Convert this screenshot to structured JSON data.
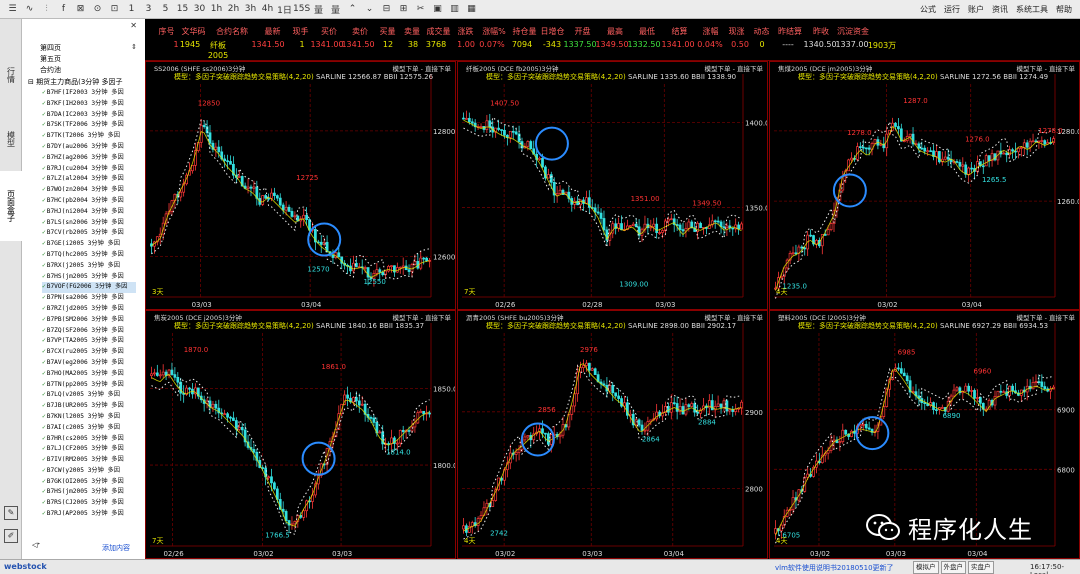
{
  "toolbar": {
    "icons": [
      "list-icon",
      "line-chart-icon",
      "candle-chart-icon",
      "formula-icon",
      "close-icon",
      "clock-icon",
      "tick-icon",
      "1m",
      "3m",
      "5m",
      "15m",
      "30m",
      "1h",
      "2h",
      "3h",
      "4h",
      "1d",
      "15s",
      "week-icon",
      "month-icon",
      "zoom-in-icon",
      "zoom-out-icon",
      "collapse-icon",
      "expand-icon",
      "scissors-icon",
      "fullscreen-icon",
      "align-icon",
      "grid-icon"
    ],
    "icon_glyphs": [
      "☰",
      "∿",
      "⫶",
      "f",
      "⊠",
      "⊙",
      "⊡",
      "1",
      "3",
      "5",
      "15",
      "30",
      "1h",
      "2h",
      "3h",
      "4h",
      "1日",
      "15S",
      "量",
      "量",
      "⌃",
      "⌄",
      "⊟",
      "⊞",
      "✂",
      "▣",
      "▥",
      "▦"
    ],
    "menu": [
      "公式",
      "运行",
      "账户",
      "资讯",
      "系统工具",
      "帮助"
    ]
  },
  "left_tabs": [
    "行情",
    "模型",
    "页面盒子"
  ],
  "sidebar": {
    "pages": [
      "第四页",
      "第五页",
      "合约池"
    ],
    "tree_root": "期货主力商品(3分钟 多因子",
    "items": [
      "B7HF(IF2003 3分钟 多因",
      "B7KF(IH2003 3分钟 多因",
      "B7DA(IC2003 3分钟 多因",
      "B7SK(TF2006 3分钟 多因",
      "B7TK(T2006 3分钟 多因",
      "B7DY(au2006 3分钟 多因",
      "B7HZ(ag2006 3分钟 多因",
      "B7RJ(cu2004 3分钟 多因",
      "B7LZ(al2004 3分钟 多因",
      "B7WO(zn2004 3分钟 多因",
      "B7HC(pb2004 3分钟 多因",
      "B7HJ(ni2004 3分钟 多因",
      "B7LS(sn2006 3分钟 多因",
      "B7CV(rb2005 3分钟 多因",
      "B7GE(i2005 3分钟 多因",
      "B7TQ(hc2005 3分钟 多因",
      "B7RX(j2005 3分钟 多因",
      "B7HS(jm2005 3分钟 多因",
      "B7VOF(FG2006 3分钟 多因",
      "B7PN(sa2006 3分钟 多因",
      "B7RZ(jd2005 3分钟 多因",
      "B7PB(SM2006 3分钟 多因",
      "B7ZQ(SF2006 3分钟 多因",
      "B7VP(TA2005 3分钟 多因",
      "B7CX(ru2005 3分钟 多因",
      "B7AV(eg2006 3分钟 多因",
      "B7HO(MA2005 3分钟 多因",
      "B7TN(pp2005 3分钟 多因",
      "B7LQ(v2005 3分钟 多因",
      "B7JB(UR2005 3分钟 多因",
      "B7KN(l2005 3分钟 多因",
      "B7AI(c2005 3分钟 多因",
      "B7HR(cs2005 3分钟 多因",
      "B7LJ(CF2005 3分钟 多因",
      "B7IV(RM2005 3分钟 多因",
      "B7CW(y2005 3分钟 多因",
      "B7GK(OI2005 3分钟 多因",
      "B7HS(jm2005 3分钟 多因",
      "B7RS(CJ2005 3分钟 多因",
      "B7RJ(AP2005 3分钟 多因"
    ],
    "selected_index": 18,
    "add_label": "添加内容"
  },
  "quote": {
    "headers": [
      "序号",
      "文华码",
      "合约名称",
      "最新",
      "现手",
      "买价",
      "卖价",
      "买量",
      "卖量",
      "成交量",
      "涨跌",
      "涨幅%",
      "持仓量",
      "日增仓",
      "开盘",
      "最高",
      "最低",
      "结算",
      "涨幅",
      "现涨",
      "动态",
      "昨结算",
      "昨收",
      "沉淀资金"
    ],
    "values": [
      "1",
      "1945",
      "纤板2005",
      "1341.50",
      "1",
      "1341.00",
      "1341.50",
      "12",
      "38",
      "3768",
      "1.00",
      "0.07%",
      "7094",
      "-343",
      "1337.50",
      "1349.50",
      "1332.50",
      "1341.00",
      "0.04%",
      "0.50",
      "0",
      "----",
      "1340.50",
      "1337.00",
      "1903万"
    ],
    "value_colors": [
      "#ff4040",
      "#e6e600",
      "#e6e600",
      "#ff4040",
      "#e6e600",
      "#ff4040",
      "#ff4040",
      "#e6e600",
      "#e6e600",
      "#e6e600",
      "#ff4040",
      "#ff4040",
      "#e6e600",
      "#e6e600",
      "#3ee03e",
      "#ff4040",
      "#3ee03e",
      "#ff4040",
      "#ff4040",
      "#ff4040",
      "#e6e600",
      "#ddd",
      "#ddd",
      "#ddd",
      "#e6e600"
    ]
  },
  "model": {
    "name": "模型：多因子突破跟踪趋势交易策略(4,2,20)",
    "order_label": "模型下单 - 直接下单"
  },
  "panels": [
    {
      "title": "SS2006 (SHFE ss2006)3分钟",
      "sarline": "SARLINE 12566.87",
      "bbii": "BBII 12575.26",
      "yticks": [
        {
          "v": "12800",
          "p": 0.22
        },
        {
          "v": "12600",
          "p": 0.81
        }
      ],
      "xticks": [
        {
          "v": "03/03",
          "p": 0.18
        },
        {
          "v": "03/04",
          "p": 0.57
        }
      ],
      "period": "3天",
      "labels": [
        {
          "t": "12850",
          "x": 0.17,
          "y": 0.1,
          "c": "red"
        },
        {
          "t": "12725",
          "x": 0.52,
          "y": 0.45,
          "c": "red"
        },
        {
          "t": "12570",
          "x": 0.56,
          "y": 0.88,
          "c": "cyan"
        },
        {
          "t": "12550",
          "x": 0.76,
          "y": 0.94,
          "c": "cyan"
        }
      ],
      "circle": {
        "x": 0.62,
        "y": 0.73
      },
      "path": [
        0.75,
        0.72,
        0.6,
        0.52,
        0.45,
        0.35,
        0.2,
        0.28,
        0.32,
        0.38,
        0.42,
        0.48,
        0.5,
        0.55,
        0.52,
        0.56,
        0.6,
        0.64,
        0.62,
        0.7,
        0.75,
        0.78,
        0.8,
        0.84,
        0.86,
        0.85,
        0.9,
        0.88,
        0.86,
        0.87,
        0.85,
        0.86,
        0.83,
        0.82
      ]
    },
    {
      "title": "纤板2005 (DCE fb2005)3分钟",
      "sarline": "SARLINE 1335.60",
      "bbii": "BBII 1338.90",
      "yticks": [
        {
          "v": "1400.00",
          "p": 0.18
        },
        {
          "v": "1350.00",
          "p": 0.58
        }
      ],
      "xticks": [
        {
          "v": "02/26",
          "p": 0.15
        },
        {
          "v": "02/28",
          "p": 0.46
        },
        {
          "v": "03/03",
          "p": 0.72
        }
      ],
      "period": "7天",
      "labels": [
        {
          "t": "1407.50",
          "x": 0.1,
          "y": 0.1,
          "c": "red"
        },
        {
          "t": "1351.00",
          "x": 0.6,
          "y": 0.55,
          "c": "red"
        },
        {
          "t": "1349.50",
          "x": 0.82,
          "y": 0.57,
          "c": "red"
        },
        {
          "t": "1309.00",
          "x": 0.56,
          "y": 0.95,
          "c": "cyan"
        }
      ],
      "circle": {
        "x": 0.32,
        "y": 0.28
      },
      "path": [
        0.16,
        0.18,
        0.2,
        0.19,
        0.22,
        0.24,
        0.25,
        0.28,
        0.3,
        0.36,
        0.44,
        0.52,
        0.5,
        0.55,
        0.54,
        0.56,
        0.62,
        0.72,
        0.66,
        0.68,
        0.66,
        0.7,
        0.65,
        0.68,
        0.66,
        0.64,
        0.7,
        0.66,
        0.68,
        0.66,
        0.64,
        0.68,
        0.66,
        0.68
      ]
    },
    {
      "title": "焦煤2005 (DCE jm2005)3分钟",
      "sarline": "SARLINE 1272.56",
      "bbii": "BBII 1274.49",
      "yticks": [
        {
          "v": "1280.0",
          "p": 0.22
        },
        {
          "v": "1260.0",
          "p": 0.55
        }
      ],
      "xticks": [
        {
          "v": "03/02",
          "p": 0.4
        },
        {
          "v": "03/04",
          "p": 0.7
        }
      ],
      "period": "4天",
      "labels": [
        {
          "t": "1278.0",
          "x": 0.26,
          "y": 0.24,
          "c": "red"
        },
        {
          "t": "1287.0",
          "x": 0.46,
          "y": 0.09,
          "c": "red"
        },
        {
          "t": "1276.0",
          "x": 0.68,
          "y": 0.27,
          "c": "red"
        },
        {
          "t": "1278.0",
          "x": 0.94,
          "y": 0.23,
          "c": "red"
        },
        {
          "t": "1265.5",
          "x": 0.74,
          "y": 0.46,
          "c": "cyan"
        },
        {
          "t": "1235.0",
          "x": 0.03,
          "y": 0.96,
          "c": "cyan"
        }
      ],
      "circle": {
        "x": 0.27,
        "y": 0.5
      },
      "path": [
        0.96,
        0.85,
        0.8,
        0.78,
        0.72,
        0.75,
        0.68,
        0.6,
        0.42,
        0.36,
        0.3,
        0.33,
        0.26,
        0.28,
        0.18,
        0.26,
        0.24,
        0.3,
        0.32,
        0.33,
        0.36,
        0.34,
        0.4,
        0.42,
        0.38,
        0.36,
        0.34,
        0.3,
        0.32,
        0.28,
        0.3,
        0.26,
        0.28,
        0.26
      ]
    },
    {
      "title": "焦炭2005 (DCE j2005)3分钟",
      "sarline": "SARLINE 1840.16",
      "bbii": "BBII 1835.37",
      "yticks": [
        {
          "v": "1850.0",
          "p": 0.26
        },
        {
          "v": "1800.0",
          "p": 0.62
        }
      ],
      "xticks": [
        {
          "v": "02/26",
          "p": 0.08
        },
        {
          "v": "03/02",
          "p": 0.4
        },
        {
          "v": "03/03",
          "p": 0.68
        }
      ],
      "period": "7天",
      "labels": [
        {
          "t": "1870.0",
          "x": 0.12,
          "y": 0.09,
          "c": "red"
        },
        {
          "t": "1861.0",
          "x": 0.61,
          "y": 0.17,
          "c": "red"
        },
        {
          "t": "1814.0",
          "x": 0.84,
          "y": 0.57,
          "c": "cyan"
        },
        {
          "t": "1766.5",
          "x": 0.41,
          "y": 0.96,
          "c": "cyan"
        }
      ],
      "circle": {
        "x": 0.6,
        "y": 0.59
      },
      "path": [
        0.2,
        0.22,
        0.18,
        0.24,
        0.28,
        0.26,
        0.3,
        0.34,
        0.36,
        0.4,
        0.44,
        0.48,
        0.55,
        0.62,
        0.7,
        0.78,
        0.88,
        0.9,
        0.82,
        0.76,
        0.65,
        0.55,
        0.42,
        0.3,
        0.32,
        0.35,
        0.4,
        0.48,
        0.52,
        0.5,
        0.46,
        0.42,
        0.38,
        0.36
      ]
    },
    {
      "title": "沥青2005 (SHFE bu2005)3分钟",
      "sarline": "SARLINE 2898.00",
      "bbii": "BBII 2902.17",
      "yticks": [
        {
          "v": "2900",
          "p": 0.37
        },
        {
          "v": "2800",
          "p": 0.73
        }
      ],
      "xticks": [
        {
          "v": "03/02",
          "p": 0.15
        },
        {
          "v": "03/03",
          "p": 0.46
        },
        {
          "v": "03/04",
          "p": 0.75
        }
      ],
      "period": "4天",
      "labels": [
        {
          "t": "2976",
          "x": 0.42,
          "y": 0.09,
          "c": "red"
        },
        {
          "t": "2856",
          "x": 0.27,
          "y": 0.37,
          "c": "red"
        },
        {
          "t": "2864",
          "x": 0.64,
          "y": 0.51,
          "c": "cyan"
        },
        {
          "t": "2884",
          "x": 0.84,
          "y": 0.43,
          "c": "cyan"
        },
        {
          "t": "2742",
          "x": 0.1,
          "y": 0.95,
          "c": "cyan"
        }
      ],
      "circle": {
        "x": 0.27,
        "y": 0.5
      },
      "path": [
        0.92,
        0.9,
        0.88,
        0.8,
        0.72,
        0.62,
        0.55,
        0.52,
        0.48,
        0.45,
        0.5,
        0.48,
        0.44,
        0.3,
        0.12,
        0.18,
        0.22,
        0.25,
        0.3,
        0.33,
        0.4,
        0.46,
        0.42,
        0.38,
        0.36,
        0.34,
        0.36,
        0.34,
        0.36,
        0.33,
        0.35,
        0.34,
        0.35,
        0.34
      ]
    },
    {
      "title": "塑料2005 (DCE l2005)3分钟",
      "sarline": "SARLINE 6927.29",
      "bbii": "BBII 6934.53",
      "yticks": [
        {
          "v": "6900",
          "p": 0.36
        },
        {
          "v": "6800",
          "p": 0.64
        }
      ],
      "xticks": [
        {
          "v": "03/02",
          "p": 0.16
        },
        {
          "v": "03/03",
          "p": 0.43
        },
        {
          "v": "03/04",
          "p": 0.72
        }
      ],
      "period": "4天",
      "labels": [
        {
          "t": "6985",
          "x": 0.44,
          "y": 0.1,
          "c": "red"
        },
        {
          "t": "6960",
          "x": 0.71,
          "y": 0.19,
          "c": "red"
        },
        {
          "t": "6890",
          "x": 0.6,
          "y": 0.4,
          "c": "cyan"
        },
        {
          "t": "6705",
          "x": 0.03,
          "y": 0.96,
          "c": "cyan"
        }
      ],
      "circle": {
        "x": 0.35,
        "y": 0.47
      },
      "path": [
        0.94,
        0.86,
        0.8,
        0.74,
        0.66,
        0.6,
        0.55,
        0.5,
        0.48,
        0.46,
        0.44,
        0.45,
        0.46,
        0.3,
        0.15,
        0.2,
        0.26,
        0.3,
        0.32,
        0.34,
        0.36,
        0.3,
        0.26,
        0.28,
        0.32,
        0.36,
        0.3,
        0.28,
        0.26,
        0.28,
        0.25,
        0.24,
        0.26,
        0.25
      ]
    }
  ],
  "status": {
    "logo": "webstock",
    "notice": "vlm软件使用说明书20180510更新了",
    "buttons": [
      "模拟户",
      "外盘户",
      "实盘户"
    ],
    "time": "16:17:50-Local"
  },
  "watermark": {
    "text": "程序化人生"
  }
}
